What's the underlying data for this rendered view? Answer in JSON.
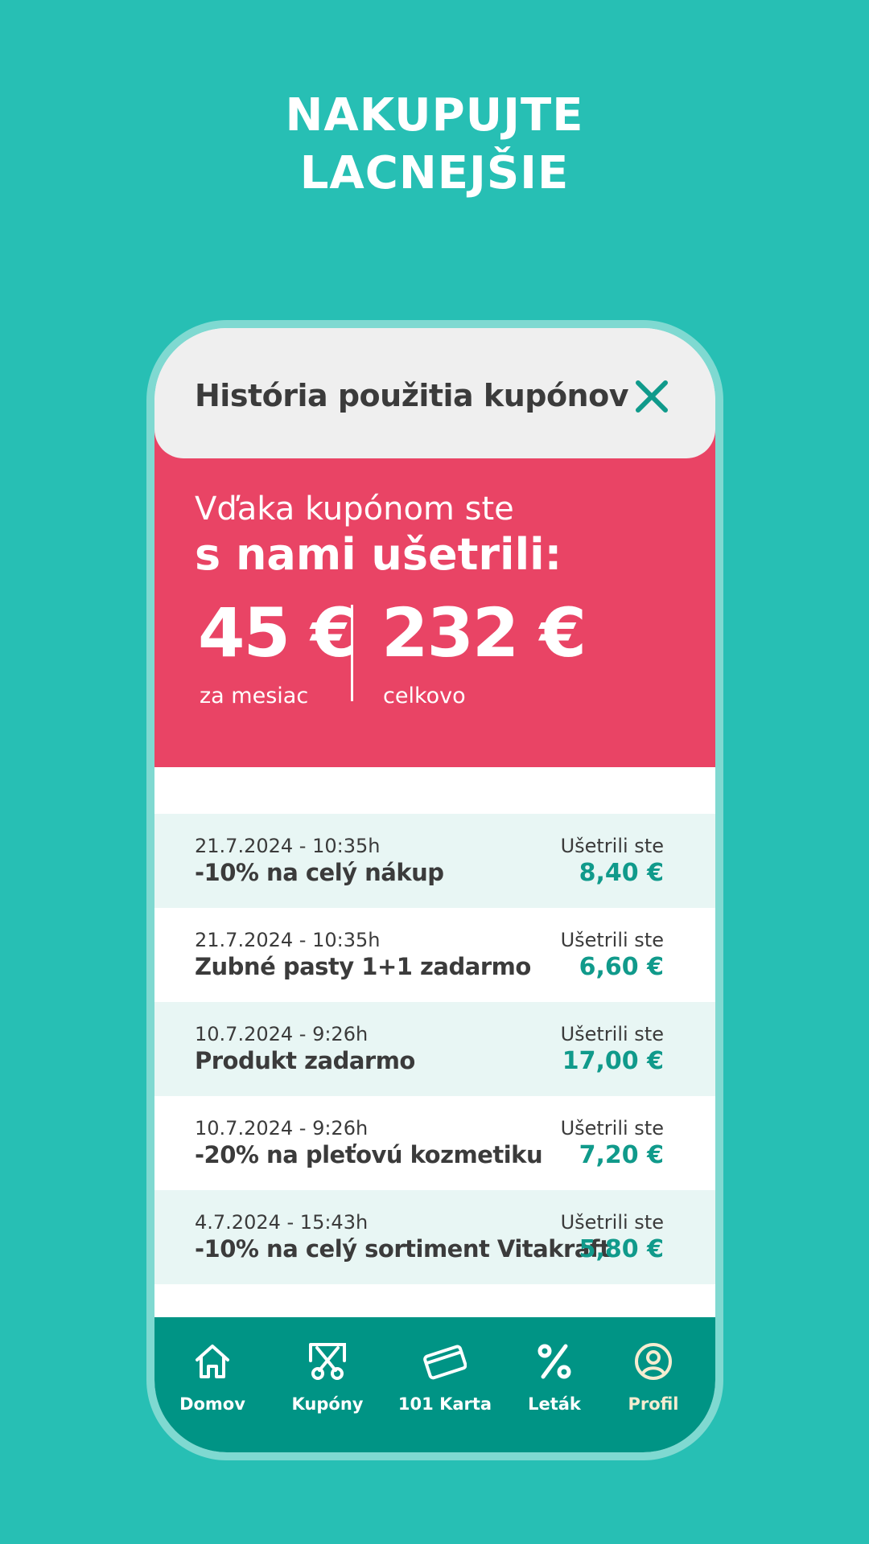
{
  "headline": {
    "line1": "NAKUPUJTE",
    "line2": "LACNEJŠIE"
  },
  "header": {
    "title": "História použitia kupónov",
    "close_icon": "close-icon"
  },
  "savings": {
    "line1": "Vďaka kupónom ste",
    "line2": "s nami ušetrili:",
    "month_amount": "45 €",
    "month_label": "za mesiac",
    "total_amount": "232 €",
    "total_label": "celkovo"
  },
  "history": [
    {
      "date": "21.7.2024 - 10:35h",
      "title": "-10% na celý nákup",
      "label": "Ušetrili ste",
      "amount": "8,40 €"
    },
    {
      "date": "21.7.2024 - 10:35h",
      "title": "Zubné pasty 1+1 zadarmo",
      "label": "Ušetrili ste",
      "amount": "6,60 €"
    },
    {
      "date": "10.7.2024 - 9:26h",
      "title": "Produkt zadarmo",
      "label": "Ušetrili ste",
      "amount": "17,00 €"
    },
    {
      "date": "10.7.2024 - 9:26h",
      "title": "-20% na pleťovú kozmetiku",
      "label": "Ušetrili ste",
      "amount": "7,20 €"
    },
    {
      "date": "4.7.2024 - 15:43h",
      "title": "-10% na celý sortiment Vitakraft",
      "label": "Ušetrili ste",
      "amount": "5,80 €"
    }
  ],
  "nav": {
    "items": [
      {
        "label": "Domov",
        "icon": "home-icon"
      },
      {
        "label": "Kupóny",
        "icon": "scissors-coupon-icon"
      },
      {
        "label": "101 Karta",
        "icon": "card-icon"
      },
      {
        "label": "Leták",
        "icon": "percent-icon"
      },
      {
        "label": "Profil",
        "icon": "profile-icon"
      }
    ],
    "active": "Profil"
  },
  "colors": {
    "background": "#27bfb4",
    "accent_red": "#e94465",
    "nav": "#009485",
    "amount_green": "#109a8b"
  }
}
